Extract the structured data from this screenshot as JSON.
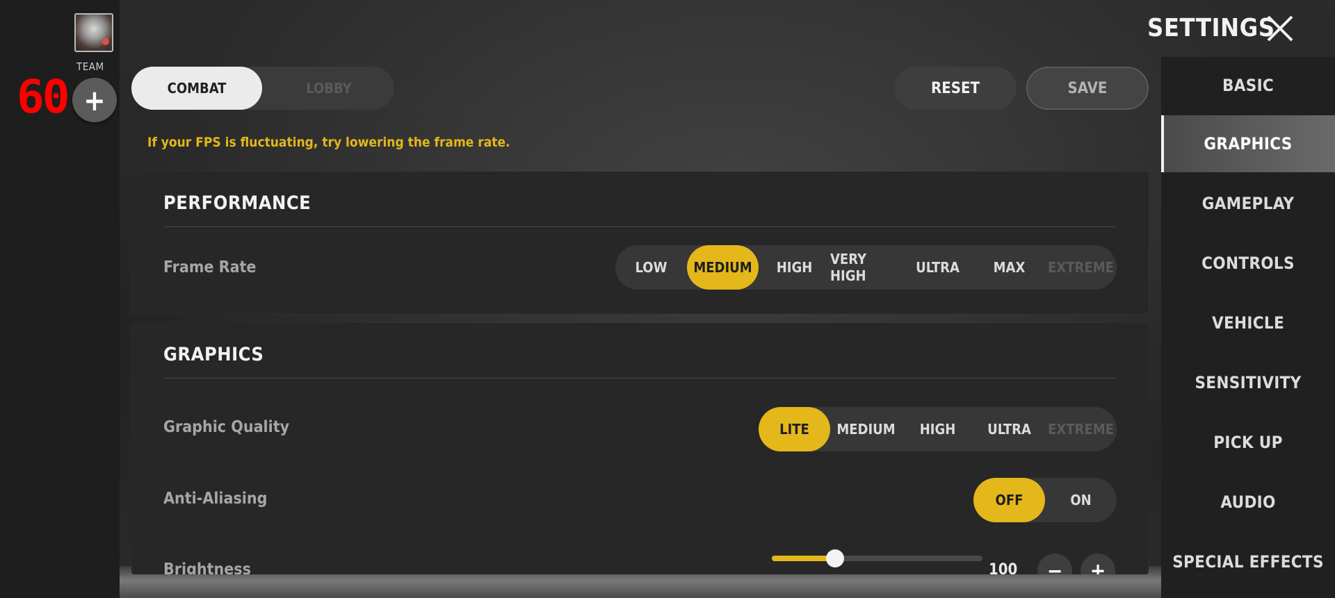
{
  "left_panel": {
    "team_label": "TEAM",
    "fps_counter": "60",
    "add_team_icon": "plus-icon"
  },
  "header": {
    "title": "SETTINGS",
    "close_icon": "close-icon"
  },
  "mode_tabs": [
    {
      "label": "COMBAT",
      "active": true
    },
    {
      "label": "LOBBY",
      "active": false
    }
  ],
  "actions": {
    "reset_label": "RESET",
    "save_label": "SAVE"
  },
  "hint": "If your FPS is fluctuating, try lowering the frame rate.",
  "performance": {
    "title": "PERFORMANCE",
    "frame_rate": {
      "label": "Frame Rate",
      "options": [
        "LOW",
        "MEDIUM",
        "HIGH",
        "VERY HIGH",
        "ULTRA",
        "MAX",
        "EXTREME"
      ],
      "selected": "MEDIUM",
      "disabled": [
        "EXTREME"
      ]
    }
  },
  "graphics": {
    "title": "GRAPHICS",
    "graphic_quality": {
      "label": "Graphic Quality",
      "options": [
        "LITE",
        "MEDIUM",
        "HIGH",
        "ULTRA",
        "EXTREME"
      ],
      "selected": "LITE",
      "disabled": [
        "EXTREME"
      ]
    },
    "anti_aliasing": {
      "label": "Anti-Aliasing",
      "options": [
        "OFF",
        "ON"
      ],
      "selected": "OFF"
    },
    "brightness": {
      "label": "Brightness",
      "value": "100",
      "level_fraction": 0.3,
      "minus_icon": "minus-icon",
      "plus_icon": "plus-icon"
    }
  },
  "sidebar": {
    "items": [
      {
        "label": "BASIC",
        "active": false
      },
      {
        "label": "GRAPHICS",
        "active": true
      },
      {
        "label": "GAMEPLAY",
        "active": false
      },
      {
        "label": "CONTROLS",
        "active": false
      },
      {
        "label": "VEHICLE",
        "active": false
      },
      {
        "label": "SENSITIVITY",
        "active": false
      },
      {
        "label": "PICK UP",
        "active": false
      },
      {
        "label": "AUDIO",
        "active": false
      },
      {
        "label": "SPECIAL EFFECTS",
        "active": false
      }
    ]
  },
  "colors": {
    "accent": "#e4b71a",
    "fps_counter": "#ff0000"
  }
}
